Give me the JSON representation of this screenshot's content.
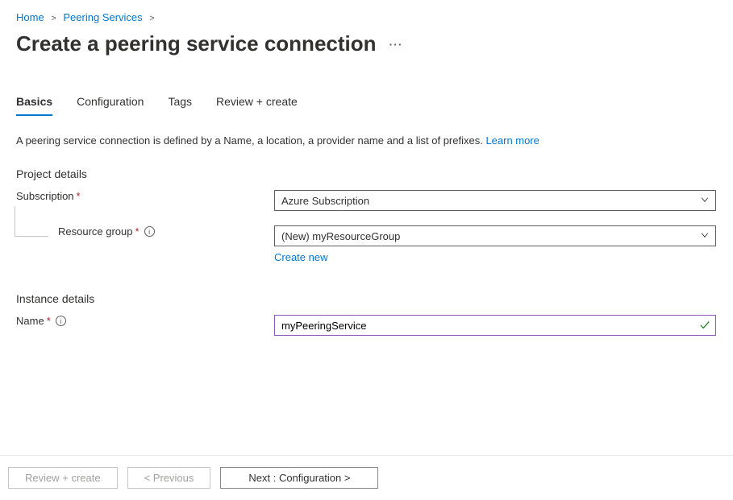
{
  "breadcrumb": {
    "home": "Home",
    "level1": "Peering Services"
  },
  "header": {
    "title": "Create a peering service connection"
  },
  "tabs": {
    "basics": "Basics",
    "configuration": "Configuration",
    "tags": "Tags",
    "review": "Review + create"
  },
  "intro": {
    "text": "A peering service connection is defined by a Name, a location, a provider name and a list of prefixes. ",
    "learn_more": "Learn more"
  },
  "sections": {
    "project": "Project details",
    "instance": "Instance details"
  },
  "labels": {
    "subscription": "Subscription",
    "resource_group": "Resource group",
    "name": "Name"
  },
  "values": {
    "subscription": "Azure Subscription",
    "resource_group": "(New) myResourceGroup",
    "name": "myPeeringService"
  },
  "links": {
    "create_new": "Create new"
  },
  "buttons": {
    "review_create": "Review + create",
    "previous": "< Previous",
    "next": "Next : Configuration >"
  }
}
